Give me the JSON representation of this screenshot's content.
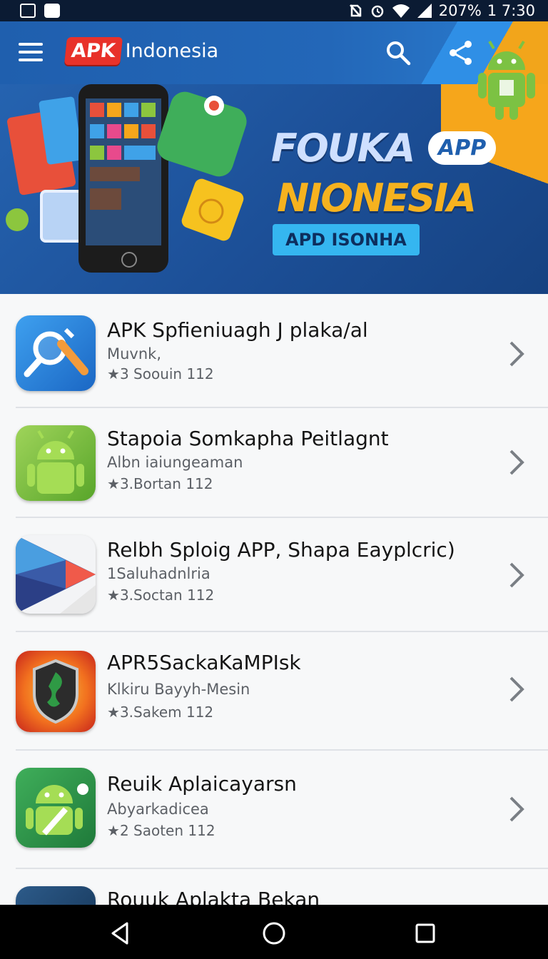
{
  "status_bar": {
    "battery": "207%",
    "time": "1 7:30",
    "icons": [
      "image-icon",
      "inbox-icon",
      "no-sim-icon",
      "alarm-icon",
      "wifi-icon",
      "signal-icon"
    ]
  },
  "app_bar": {
    "logo_badge": "APK",
    "logo_text": "Indonesia",
    "actions": [
      "menu-icon",
      "search-icon",
      "share-icon"
    ]
  },
  "banner": {
    "title": "FOUKA",
    "title_reg": "®",
    "pill": "APP",
    "subtitle": "NIONESIA",
    "subtitle_reg": "®",
    "tag": "APD ISONHA"
  },
  "apps": [
    {
      "name": "APK Spfieniuagh J plaka/al",
      "subtitle": "Muvnk,",
      "rating": "3 Soouin 112",
      "icon": "search-tool-icon"
    },
    {
      "name": "Stapoia Somkapha Peitlagnt",
      "subtitle": "Albn iaiungeaman",
      "rating": "3.Bortan 112",
      "icon": "android-icon"
    },
    {
      "name": "Relbh Sploig APP, Shapa Eayplcric)",
      "subtitle": "1Saluhadnlria",
      "rating": "3.Soctan 112",
      "icon": "play-store-icon"
    },
    {
      "name": "APR5SackaKaMPIsk",
      "subtitle": "Klkiru Bayyh-Mesin",
      "rating": "3.Sakem 112",
      "icon": "shield-icon"
    },
    {
      "name": "Reuik Aplaicayarsn",
      "subtitle": "Abyarkadicea",
      "rating": "2 Saoten 112",
      "icon": "android-settings-icon"
    },
    {
      "name": "Rouuk Aplakta Bekan",
      "subtitle": "",
      "rating": "",
      "icon": "app-icon"
    }
  ],
  "nav_bar": [
    "back-icon",
    "home-icon",
    "recents-icon"
  ],
  "colors": {
    "brand_blue": "#1f5fae",
    "accent_orange": "#f6a61b",
    "logo_red": "#e8322a",
    "android_green": "#7cc243"
  }
}
